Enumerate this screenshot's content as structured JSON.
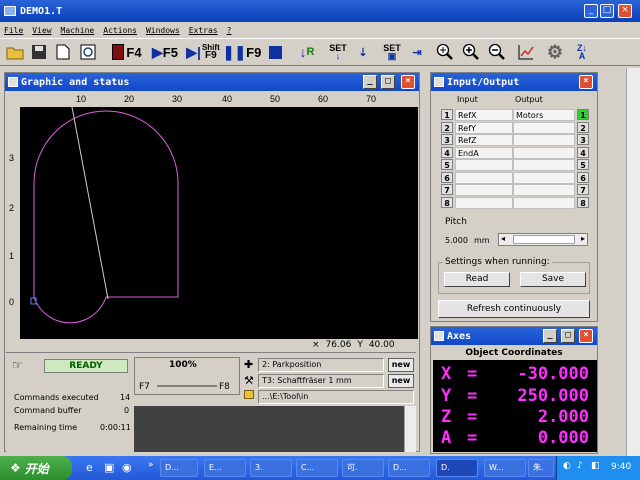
{
  "app": {
    "title": "DEMO1.T",
    "window_buttons": {
      "minimize": "_",
      "maximize": "□",
      "close": "×"
    }
  },
  "menu": [
    "File",
    "View",
    "Machine",
    "Actions",
    "Windows",
    "Extras",
    "?"
  ],
  "toolbar": {
    "f4": "F4",
    "f5": "F5",
    "shift_label": "Shift",
    "f9a": "F9",
    "f9b": "F9",
    "r_label": "R",
    "set_label": "SET",
    "set_label2": "SET"
  },
  "graphic": {
    "title": "Graphic and status",
    "ruler_top": [
      "10",
      "20",
      "30",
      "40",
      "50",
      "60",
      "70"
    ],
    "ruler_left": [
      "3",
      "2",
      "1",
      "0"
    ],
    "coord_x": "76.06",
    "coord_y": "40.00",
    "status": "READY",
    "feed_percent": "100%",
    "f7": "F7",
    "f8": "F8",
    "part_position": "2: Parkposition",
    "tool": "T3: Schaftfräser 1 mm",
    "tool_path": "...\\E:\\Tool\\in",
    "new1": "new",
    "new2": "new",
    "cmd_executed_label": "Commands executed",
    "cmd_executed_value": "14",
    "cmd_buffer_label": "Command buffer",
    "cmd_buffer_value": "0",
    "remaining_label": "Remaining time",
    "remaining_value": "0:00:11"
  },
  "io": {
    "title": "Input/Output",
    "header_input": "Input",
    "header_output": "Output",
    "rows": [
      {
        "num": "1",
        "input": "RefX",
        "output": "Motors",
        "active": true
      },
      {
        "num": "2",
        "input": "RefY",
        "output": "",
        "active": false
      },
      {
        "num": "3",
        "input": "RefZ",
        "output": "",
        "active": false
      },
      {
        "num": "4",
        "input": "EndA",
        "output": "",
        "active": false
      },
      {
        "num": "5",
        "input": "",
        "output": "",
        "active": false
      },
      {
        "num": "6",
        "input": "",
        "output": "",
        "active": false
      },
      {
        "num": "7",
        "input": "",
        "output": "",
        "active": false
      },
      {
        "num": "8",
        "input": "",
        "output": "",
        "active": false
      }
    ],
    "pitch_label": "Pitch",
    "pitch_value": "5.000",
    "pitch_unit": "mm",
    "settings_label": "Settings when running:",
    "read": "Read",
    "save": "Save",
    "refresh": "Refresh continuously"
  },
  "axes": {
    "title": "Axes",
    "subtitle": "Object Coordinates",
    "rows": [
      {
        "axis": "X",
        "value": "-30.000"
      },
      {
        "axis": "Y",
        "value": "250.000"
      },
      {
        "axis": "Z",
        "value": "2.000"
      },
      {
        "axis": "A",
        "value": "0.000"
      }
    ]
  },
  "taskbar": {
    "start": "开始",
    "tasks": [
      "D...",
      "E...",
      "3.",
      "C...",
      "可.",
      "D...",
      "D.",
      "W...",
      "朱."
    ],
    "clock": "9:40"
  },
  "colors": {
    "accent": "#0a3fb8",
    "axis_text": "#ff30ff",
    "contour": "#e060e0",
    "ready": "#006000"
  }
}
